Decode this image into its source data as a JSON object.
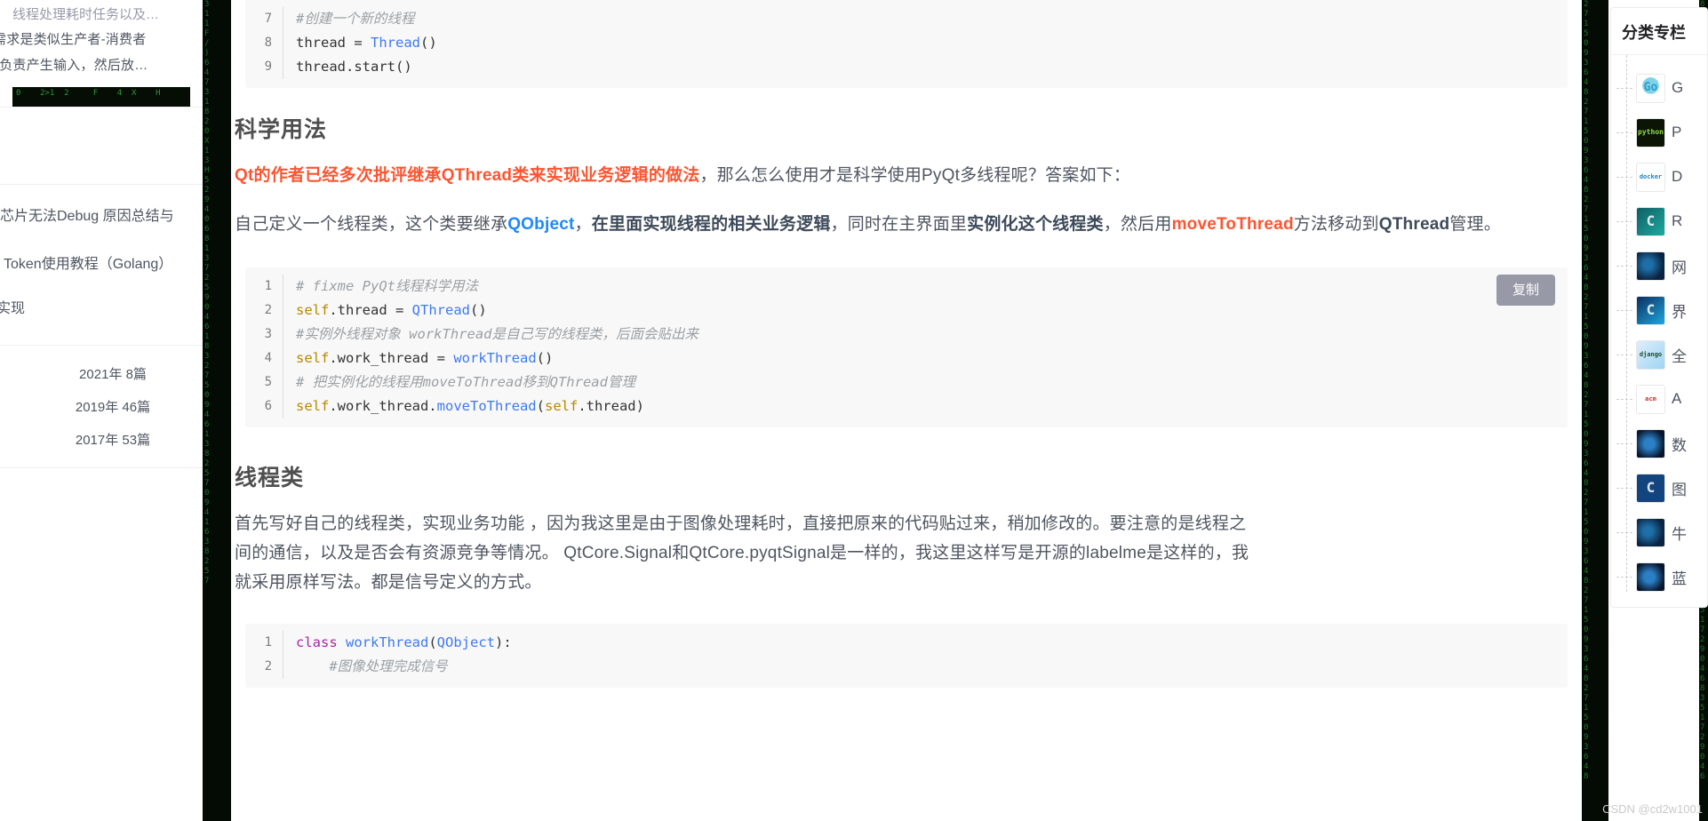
{
  "left_sidebar": {
    "recommend": {
      "title": "线程处理耗时任务以及…",
      "line1": "需求是类似生产者-消费者",
      "line2": "程负责产生输入，然后放…"
    },
    "links": [
      "芯片无法Debug 原因总结与",
      "Token使用教程（Golang）",
      "实现"
    ],
    "archive": [
      "2021年  8篇",
      "2019年  46篇",
      "2017年  53篇"
    ]
  },
  "main": {
    "top_code": {
      "lines": [
        {
          "n": "7",
          "tokens": [
            {
              "t": "#创建一个新的线程",
              "c": "cm"
            }
          ]
        },
        {
          "n": "8",
          "tokens": [
            {
              "t": "thread ",
              "c": "pl"
            },
            {
              "t": "= ",
              "c": "op"
            },
            {
              "t": "Thread",
              "c": "fn"
            },
            {
              "t": "()",
              "c": "op"
            }
          ]
        },
        {
          "n": "9",
          "tokens": [
            {
              "t": "thread",
              "c": "pl"
            },
            {
              "t": ".start()",
              "c": "op"
            }
          ]
        }
      ]
    },
    "section1": {
      "heading": "科学用法",
      "p1": {
        "red": "Qt的作者已经多次批评继承QThread类来实现业务逻辑的做法",
        "rest": "，那么怎么使用才是科学使用PyQt多线程呢？答案如下："
      },
      "p2": {
        "s1": "自己定义一个线程类，这个类要继承",
        "blue": "QObject",
        "s2": "，",
        "b1": "在里面实现线程的相关业务逻辑",
        "s3": "，同时在主界面里",
        "b2": "实例化这个线程类",
        "s4": "，然后用",
        "red2": "moveToThread",
        "s5": "方法移动到",
        "b3": "QThread",
        "s6": "管理。"
      }
    },
    "code1": {
      "copy_label": "复制",
      "lines": [
        {
          "n": "1",
          "tokens": [
            {
              "t": "# fixme PyQt线程科学用法",
              "c": "cm"
            }
          ]
        },
        {
          "n": "2",
          "tokens": [
            {
              "t": "self",
              "c": "self"
            },
            {
              "t": ".thread ",
              "c": "pl"
            },
            {
              "t": "= ",
              "c": "op"
            },
            {
              "t": "QThread",
              "c": "fn"
            },
            {
              "t": "()",
              "c": "op"
            }
          ]
        },
        {
          "n": "3",
          "tokens": [
            {
              "t": "#实例外线程对象 workThread是自己写的线程类，后面会贴出来",
              "c": "cm"
            }
          ]
        },
        {
          "n": "4",
          "tokens": [
            {
              "t": "self",
              "c": "self"
            },
            {
              "t": ".work_thread ",
              "c": "pl"
            },
            {
              "t": "= ",
              "c": "op"
            },
            {
              "t": "workThread",
              "c": "fn"
            },
            {
              "t": "()",
              "c": "op"
            }
          ]
        },
        {
          "n": "5",
          "tokens": [
            {
              "t": "# 把实例化的线程用moveToThread移到QThread管理",
              "c": "cm"
            }
          ]
        },
        {
          "n": "6",
          "tokens": [
            {
              "t": "self",
              "c": "self"
            },
            {
              "t": ".work_thread.",
              "c": "pl"
            },
            {
              "t": "moveToThread",
              "c": "fn"
            },
            {
              "t": "(",
              "c": "op"
            },
            {
              "t": "self",
              "c": "self"
            },
            {
              "t": ".thread)",
              "c": "pl"
            }
          ]
        }
      ]
    },
    "section2": {
      "heading": "线程类",
      "p1_line1": "首先写好自己的线程类，实现业务功能 ，因为我这里是由于图像处理耗时，直接把原来的代码贴过来，稍加修改的。要注意的是线程之",
      "p1_line2": "间的通信，以及是否会有资源竞争等情况。 QtCore.Signal和QtCore.pyqtSignal是一样的，我这里这样写是开源的labelme是这样的，我",
      "p1_line3": "就采用原样写法。都是信号定义的方式。"
    },
    "code2": {
      "lines": [
        {
          "n": "1",
          "tokens": [
            {
              "t": "class ",
              "c": "kw"
            },
            {
              "t": "workThread",
              "c": "fn"
            },
            {
              "t": "(",
              "c": "op"
            },
            {
              "t": "QObject",
              "c": "fn"
            },
            {
              "t": "):",
              "c": "op"
            }
          ]
        },
        {
          "n": "2",
          "tokens": [
            {
              "t": "    #图像处理完成信号",
              "c": "cm"
            }
          ]
        }
      ]
    }
  },
  "right_sidebar": {
    "heading": "分类专栏",
    "items": [
      {
        "label": "G",
        "thumb": "go-thumb",
        "glyph": "Go"
      },
      {
        "label": "P",
        "thumb": "python-thumb",
        "glyph": "python"
      },
      {
        "label": "D",
        "thumb": "docker-thumb",
        "glyph": "docker"
      },
      {
        "label": "R",
        "thumb": "redis-thumb",
        "glyph": "C"
      },
      {
        "label": "网",
        "thumb": "network-thumb",
        "glyph": ""
      },
      {
        "label": "界",
        "thumb": "ui-thumb",
        "glyph": "C"
      },
      {
        "label": "全",
        "thumb": "django-thumb",
        "glyph": "django"
      },
      {
        "label": "A",
        "thumb": "acm-thumb",
        "glyph": "acm"
      },
      {
        "label": "数",
        "thumb": "algo-thumb",
        "glyph": ""
      },
      {
        "label": "图",
        "thumb": "image-thumb",
        "glyph": "C"
      },
      {
        "label": "牛",
        "thumb": "network-thumb",
        "glyph": ""
      },
      {
        "label": "蓝",
        "thumb": "algo-thumb",
        "glyph": ""
      }
    ]
  },
  "watermark": "CSDN @cd2w1001",
  "colors": {
    "red": "#fc5531",
    "blue": "#1e88ff",
    "code_bg": "#f8f8f8",
    "copy_btn": "#9799a7"
  }
}
